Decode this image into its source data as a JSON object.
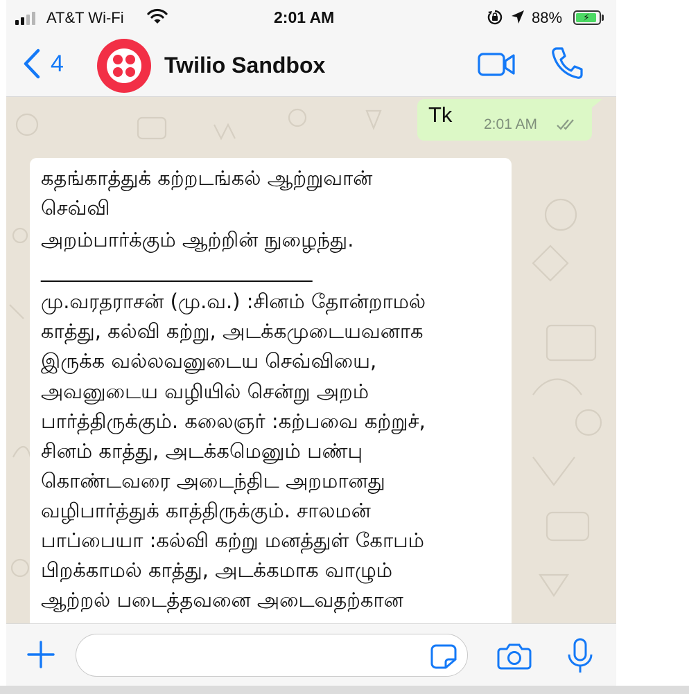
{
  "status_bar": {
    "carrier": "AT&T Wi-Fi",
    "time": "2:01 AM",
    "battery_percent": "88%",
    "battery_level": 0.88,
    "icons": [
      "signal-icon",
      "wifi-icon",
      "rotation-lock-icon",
      "location-icon",
      "battery-charging-icon"
    ]
  },
  "header": {
    "back_count": "4",
    "contact_name": "Twilio Sandbox",
    "icons": [
      "back-chevron-icon",
      "twilio-logo-icon",
      "video-call-icon",
      "phone-call-icon"
    ]
  },
  "messages": {
    "outgoing": {
      "text": "Tk",
      "time": "2:01 AM",
      "status": "read"
    },
    "incoming": {
      "lines": [
        "கதங்காத்துக்   கற்றடங்கல்    ஆற்றுவான்",
        "செவ்வி",
        "அறம்பார்க்கும்  ஆற்றின்     நுழைந்து.",
        "___________________________",
        "மு.வரதராசன் (மு.வ.) :சினம் தோன்றாமல்",
        "காத்து, கல்வி கற்று, அடக்கமுடையவனாக",
        "இருக்க வல்லவனுடைய செவ்வியை,",
        "அவனுடைய வழியில் சென்று அறம்",
        "பார்த்திருக்கும். கலைஞர் :கற்பவை கற்றுச்,",
        "சினம் காத்து, அடக்கமெனும் பண்பு",
        "கொண்டவரை அடைந்திட அறமானது",
        "வழிபார்த்துக் காத்திருக்கும். சாலமன்",
        "பாப்பையா :கல்வி கற்று மனத்துள் கோபம்",
        "பிறக்காமல் காத்து, அடக்கமாக வாழும்",
        "ஆற்றல் படைத்தவனை அடைவதற்கான"
      ]
    }
  },
  "composer": {
    "placeholder": "",
    "icons": [
      "plus-icon",
      "sticker-icon",
      "camera-icon",
      "microphone-icon"
    ]
  },
  "colors": {
    "accent": "#1479f7",
    "outgoing_bubble": "#dcf8c6",
    "chat_background": "#e9e3d8",
    "twilio_red": "#f22f46"
  }
}
